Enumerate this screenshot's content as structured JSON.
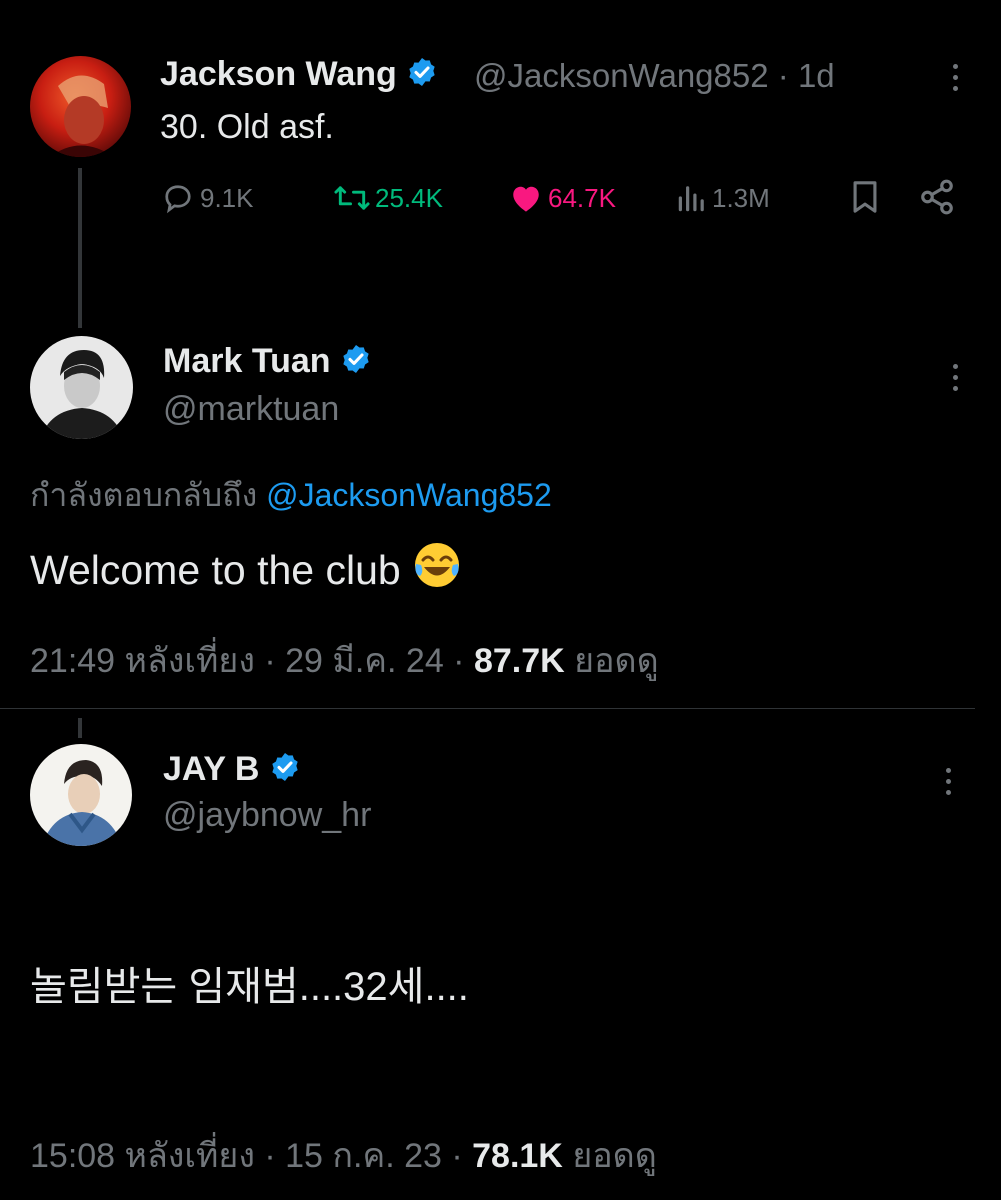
{
  "tweet1": {
    "name": "Jackson Wang",
    "handle": "@JacksonWang852",
    "sep": "·",
    "time": "1d",
    "text": "30. Old asf.",
    "replies": "9.1K",
    "retweets": "25.4K",
    "likes": "64.7K",
    "views": "1.3M"
  },
  "tweet2": {
    "name": "Mark Tuan",
    "handle": "@marktuan",
    "reply_prefix": "กำลังตอบกลับถึง",
    "reply_to": "@JacksonWang852",
    "text": "Welcome to the club",
    "emoji": "😂",
    "timestamp": "21:49 หลังเที่ยง · 29 มี.ค. 24 ·",
    "views": "87.7K",
    "views_label": "ยอดดู"
  },
  "tweet3": {
    "name": "JAY B",
    "handle": "@jaybnow_hr",
    "text": "놀림받는 임재범....32세....",
    "timestamp": "15:08 หลังเที่ยง · 15 ก.ค. 23 ·",
    "views": "78.1K",
    "views_label": "ยอดดู"
  },
  "colors": {
    "verified": "#1d9bf0",
    "retweet": "#00ba7c",
    "like": "#f91880",
    "link": "#1d9bf0",
    "muted": "#71767b"
  },
  "icons": [
    "reply-icon",
    "retweet-icon",
    "like-icon",
    "views-icon",
    "bookmark-icon",
    "share-icon",
    "verified-badge-icon",
    "more-options-icon"
  ]
}
